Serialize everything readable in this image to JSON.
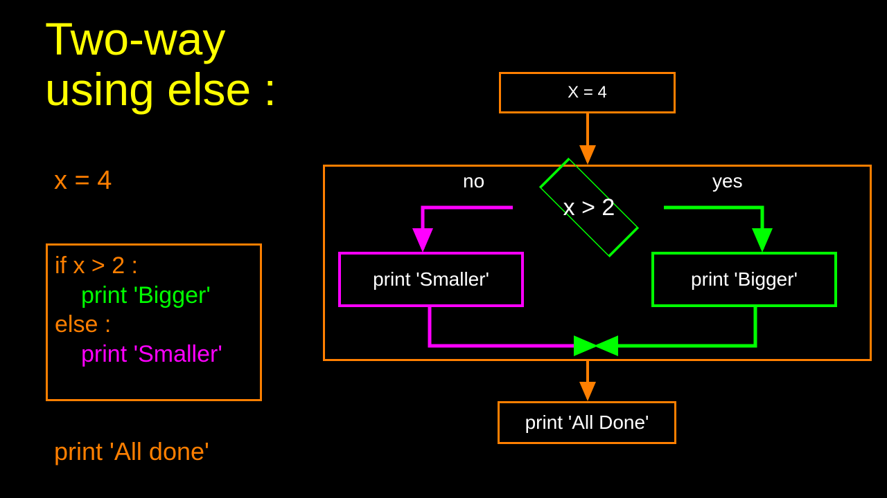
{
  "title_line1": "Two-way",
  "title_line2": "using else :",
  "code": {
    "x_assign": "x = 4",
    "if_line": "if x > 2 :",
    "bigger": "print 'Bigger'",
    "else_line": "else :",
    "smaller": "print 'Smaller'",
    "all_done": "print 'All done'"
  },
  "flow": {
    "top_box": "X = 4",
    "condition": "x > 2",
    "no_label": "no",
    "yes_label": "yes",
    "smaller_box": "print 'Smaller'",
    "bigger_box": "print 'Bigger'",
    "done_box": "print 'All Done'"
  }
}
